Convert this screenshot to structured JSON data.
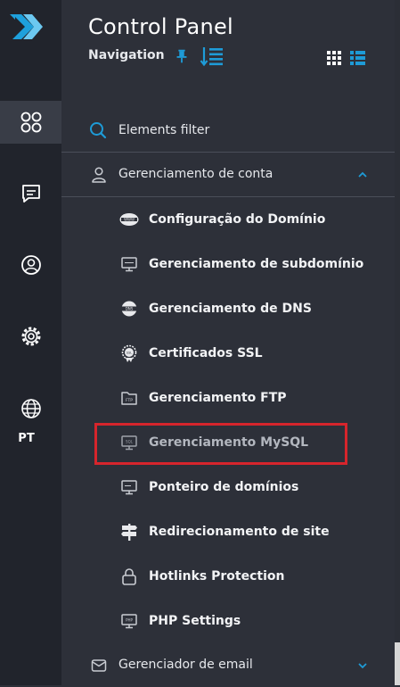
{
  "header": {
    "title": "Control Panel",
    "nav_label": "Navigation"
  },
  "rail": {
    "language": "PT",
    "active_item": "dashboard"
  },
  "filter": {
    "placeholder": "Elements filter"
  },
  "sections": {
    "account": {
      "label": "Gerenciamento de conta",
      "expanded": true
    },
    "email": {
      "label": "Gerenciador de email",
      "expanded": false
    }
  },
  "menu": {
    "items": [
      {
        "label": "Configuração do Domínio",
        "icon": "www-icon"
      },
      {
        "label": "Gerenciamento de subdomínio",
        "icon": "monitor-icon"
      },
      {
        "label": "Gerenciamento de DNS",
        "icon": "dns-icon"
      },
      {
        "label": "Certificados SSL",
        "icon": "ssl-badge-icon"
      },
      {
        "label": "Gerenciamento FTP",
        "icon": "ftp-folder-icon"
      },
      {
        "label": "Gerenciamento MySQL",
        "icon": "sql-monitor-icon",
        "highlighted": true
      },
      {
        "label": "Ponteiro de domínios",
        "icon": "pointer-monitor-icon"
      },
      {
        "label": "Redirecionamento de site",
        "icon": "signpost-icon"
      },
      {
        "label": "Hotlinks Protection",
        "icon": "lock-icon"
      },
      {
        "label": "PHP Settings",
        "icon": "php-monitor-icon"
      }
    ]
  },
  "colors": {
    "accent": "#1e9bd7",
    "highlight_border": "#d6252c",
    "sidebar_bg": "#21242c",
    "panel_bg": "#2d3039"
  }
}
